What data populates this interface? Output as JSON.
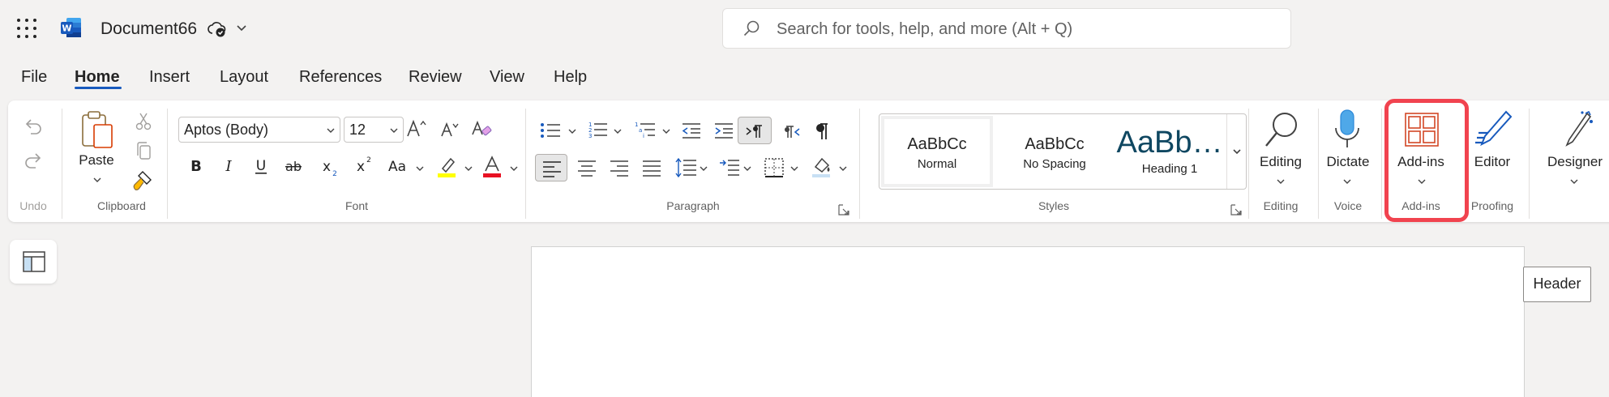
{
  "app": {
    "doc_title": "Document66",
    "search_placeholder": "Search for tools, help, and more (Alt + Q)"
  },
  "tabs": [
    "File",
    "Home",
    "Insert",
    "Layout",
    "References",
    "Review",
    "View",
    "Help"
  ],
  "active_tab": "Home",
  "ribbon": {
    "undo": {
      "label": "Undo"
    },
    "clipboard": {
      "paste": "Paste",
      "label": "Clipboard"
    },
    "font": {
      "family": "Aptos (Body)",
      "size": "12",
      "label": "Font",
      "highlight_color": "#ffff00",
      "font_color": "#e81123"
    },
    "paragraph": {
      "label": "Paragraph"
    },
    "styles": {
      "label": "Styles",
      "items": [
        {
          "preview": "AaBbCc",
          "name": "Normal"
        },
        {
          "preview": "AaBbCc",
          "name": "No Spacing"
        },
        {
          "preview": "AaBb…",
          "name": "Heading 1"
        }
      ]
    },
    "editing": {
      "button": "Editing",
      "label": "Editing"
    },
    "voice": {
      "button": "Dictate",
      "label": "Voice"
    },
    "addins": {
      "button": "Add-ins",
      "label": "Add-ins"
    },
    "proofing": {
      "button": "Editor",
      "label": "Proofing"
    },
    "designer": {
      "button": "Designer"
    }
  },
  "document": {
    "header_tag": "Header"
  },
  "colors": {
    "accent": "#185abd",
    "highlight_box": "#f1434f",
    "addins_icon": "#d24726"
  }
}
